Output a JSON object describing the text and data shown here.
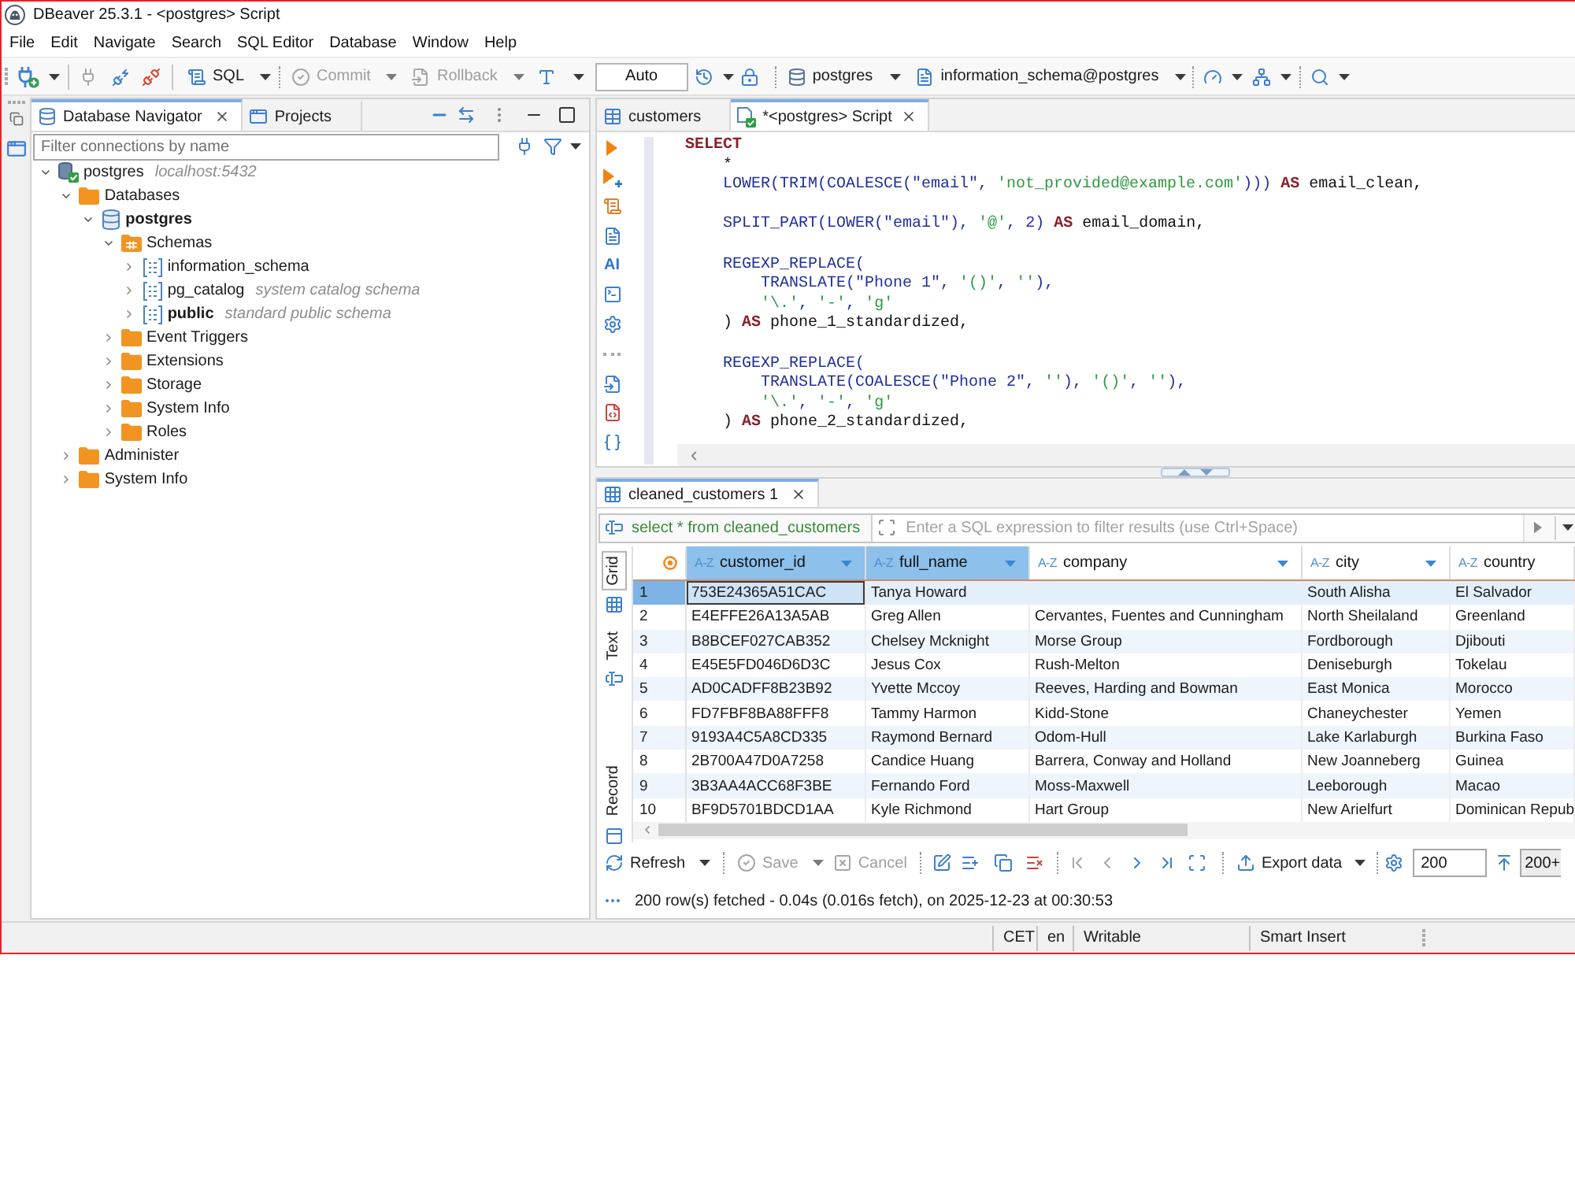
{
  "window": {
    "title": "DBeaver 25.3.1 - <postgres> Script"
  },
  "menu": [
    "File",
    "Edit",
    "Navigate",
    "Search",
    "SQL Editor",
    "Database",
    "Window",
    "Help"
  ],
  "toolbar": {
    "buttons": [
      {
        "kind": "sql",
        "label": "SQL",
        "disabled": false
      },
      {
        "kind": "commit",
        "label": "Commit",
        "disabled": true
      },
      {
        "kind": "rollback",
        "label": "Rollback",
        "disabled": true
      }
    ],
    "transaction_mode": "Auto",
    "datasource": "postgres",
    "schema": "information_schema@postgres"
  },
  "navigator": {
    "tabs": [
      {
        "kind": "database",
        "label": "Database Navigator",
        "selected": true
      },
      {
        "kind": "projects",
        "label": "Projects",
        "selected": false
      }
    ],
    "filter": {
      "placeholder": "Filter connections by name"
    },
    "tree": [
      {
        "kind": "connection",
        "label": "postgres",
        "note": "localhost:5432",
        "active": false,
        "expanded": true,
        "children": [
          {
            "kind": "folder",
            "label": "Databases",
            "active": false,
            "expanded": true,
            "children": [
              {
                "kind": "database",
                "label": "postgres",
                "active": true,
                "expanded": true,
                "children": [
                  {
                    "kind": "schemas",
                    "label": "Schemas",
                    "active": false,
                    "expanded": true,
                    "children": [
                      {
                        "kind": "schema",
                        "label": "information_schema",
                        "active": false,
                        "expanded": false
                      },
                      {
                        "kind": "schema",
                        "label": "pg_catalog",
                        "note": "system catalog schema",
                        "active": false,
                        "expanded": false
                      },
                      {
                        "kind": "schema",
                        "label": "public",
                        "note": "standard public schema",
                        "active": true,
                        "expanded": false
                      }
                    ]
                  },
                  {
                    "kind": "folder",
                    "label": "Event Triggers",
                    "active": false,
                    "expanded": false
                  },
                  {
                    "kind": "folder",
                    "label": "Extensions",
                    "active": false,
                    "expanded": false
                  },
                  {
                    "kind": "folder",
                    "label": "Storage",
                    "active": false,
                    "expanded": false
                  },
                  {
                    "kind": "folder",
                    "label": "System Info",
                    "active": false,
                    "expanded": false
                  },
                  {
                    "kind": "folder",
                    "label": "Roles",
                    "active": false,
                    "expanded": false
                  }
                ]
              }
            ]
          },
          {
            "kind": "folder",
            "label": "Administer",
            "active": false,
            "expanded": false
          },
          {
            "kind": "folder",
            "label": "System Info",
            "active": false,
            "expanded": false
          }
        ]
      }
    ]
  },
  "editor": {
    "tabs": [
      {
        "kind": "table",
        "label": "customers",
        "selected": false
      },
      {
        "kind": "script",
        "label": "*<postgres> Script",
        "selected": true
      }
    ],
    "ai_button": "AI",
    "lines": [
      {
        "kind": "code",
        "tokens": [
          {
            "kind": "keyword",
            "text": "SELECT"
          }
        ],
        "children": [
          {
            "kind": "code",
            "tokens": [
              {
                "kind": "plain",
                "text": "*"
              }
            ]
          },
          {
            "kind": "code",
            "tokens": [
              {
                "kind": "function",
                "text": "LOWER(TRIM(COALESCE(\"email\", "
              },
              {
                "kind": "string",
                "text": "'not_provided@example.com'"
              },
              {
                "kind": "function",
                "text": ")))"
              },
              {
                "kind": "keyword",
                "text": " AS"
              },
              {
                "kind": "plain",
                "text": " email_clean,"
              }
            ]
          },
          {
            "kind": "blank"
          },
          {
            "kind": "code",
            "tokens": [
              {
                "kind": "function",
                "text": "SPLIT_PART(LOWER(\"email\"), "
              },
              {
                "kind": "string",
                "text": "'@'"
              },
              {
                "kind": "function",
                "text": ", "
              },
              {
                "kind": "number",
                "text": "2"
              },
              {
                "kind": "function",
                "text": ")"
              },
              {
                "kind": "keyword",
                "text": " AS"
              },
              {
                "kind": "plain",
                "text": " email_domain,"
              }
            ]
          },
          {
            "kind": "blank"
          },
          {
            "kind": "code",
            "tokens": [
              {
                "kind": "function",
                "text": "REGEXP_REPLACE("
              }
            ],
            "children": [
              {
                "kind": "code",
                "tokens": [
                  {
                    "kind": "function",
                    "text": "TRANSLATE(\"Phone 1\", "
                  },
                  {
                    "kind": "string",
                    "text": "'()'"
                  },
                  {
                    "kind": "function",
                    "text": ", "
                  },
                  {
                    "kind": "string",
                    "text": "''"
                  },
                  {
                    "kind": "function",
                    "text": "),"
                  }
                ]
              },
              {
                "kind": "code",
                "tokens": [
                  {
                    "kind": "string",
                    "text": "'\\.'"
                  },
                  {
                    "kind": "function",
                    "text": ", "
                  },
                  {
                    "kind": "string",
                    "text": "'-'"
                  },
                  {
                    "kind": "function",
                    "text": ", "
                  },
                  {
                    "kind": "string",
                    "text": "'g'"
                  }
                ]
              }
            ]
          },
          {
            "kind": "code",
            "tokens": [
              {
                "kind": "plain",
                "text": ")"
              },
              {
                "kind": "keyword",
                "text": " AS"
              },
              {
                "kind": "plain",
                "text": " phone_1_standardized,"
              }
            ]
          },
          {
            "kind": "blank"
          },
          {
            "kind": "code",
            "tokens": [
              {
                "kind": "function",
                "text": "REGEXP_REPLACE("
              }
            ],
            "children": [
              {
                "kind": "code",
                "tokens": [
                  {
                    "kind": "function",
                    "text": "TRANSLATE(COALESCE(\"Phone 2\", "
                  },
                  {
                    "kind": "string",
                    "text": "''"
                  },
                  {
                    "kind": "function",
                    "text": "), "
                  },
                  {
                    "kind": "string",
                    "text": "'()'"
                  },
                  {
                    "kind": "function",
                    "text": ", "
                  },
                  {
                    "kind": "string",
                    "text": "''"
                  },
                  {
                    "kind": "function",
                    "text": "),"
                  }
                ]
              },
              {
                "kind": "code",
                "tokens": [
                  {
                    "kind": "string",
                    "text": "'\\.'"
                  },
                  {
                    "kind": "function",
                    "text": ", "
                  },
                  {
                    "kind": "string",
                    "text": "'-'"
                  },
                  {
                    "kind": "function",
                    "text": ", "
                  },
                  {
                    "kind": "string",
                    "text": "'g'"
                  }
                ]
              }
            ]
          },
          {
            "kind": "code",
            "tokens": [
              {
                "kind": "plain",
                "text": ")"
              },
              {
                "kind": "keyword",
                "text": " AS"
              },
              {
                "kind": "plain",
                "text": " phone_2_standardized,"
              }
            ]
          }
        ]
      }
    ]
  },
  "results": {
    "tabs": [
      {
        "label": "cleaned_customers 1",
        "selected": true
      }
    ],
    "query": "select * from cleaned_customers",
    "filter": {
      "placeholder": "Enter a SQL expression to filter results (use Ctrl+Space)"
    },
    "views": [
      {
        "kind": "grid",
        "label": "Grid",
        "selected": true
      },
      {
        "kind": "text",
        "label": "Text",
        "selected": false
      },
      {
        "kind": "record",
        "label": "Record",
        "selected": false
      }
    ],
    "table": {
      "columns": [
        {
          "type_label": "A-Z",
          "name": "customer_id",
          "selected": true
        },
        {
          "type_label": "A-Z",
          "name": "full_name",
          "selected": true
        },
        {
          "type_label": "A-Z",
          "name": "company",
          "selected": false
        },
        {
          "type_label": "A-Z",
          "name": "city",
          "selected": false
        },
        {
          "type_label": "A-Z",
          "name": "country",
          "selected": false
        }
      ],
      "rows": [
        {
          "number": "1",
          "selected": true,
          "cells": [
            "753E24365A51CAC",
            "Tanya Howard",
            null,
            "South Alisha",
            "El Salvador"
          ]
        },
        {
          "number": "2",
          "selected": false,
          "cells": [
            "E4EFFE26A13A5AB",
            "Greg Allen",
            "Cervantes, Fuentes and Cunningham",
            "North Sheilaland",
            "Greenland"
          ]
        },
        {
          "number": "3",
          "selected": false,
          "cells": [
            "B8BCEF027CAB352",
            "Chelsey Mcknight",
            "Morse Group",
            "Fordborough",
            "Djibouti"
          ]
        },
        {
          "number": "4",
          "selected": false,
          "cells": [
            "E45E5FD046D6D3C",
            "Jesus Cox",
            "Rush-Melton",
            "Deniseburgh",
            "Tokelau"
          ]
        },
        {
          "number": "5",
          "selected": false,
          "cells": [
            "AD0CADFF8B23B92",
            "Yvette Mccoy",
            "Reeves, Harding and Bowman",
            "East Monica",
            "Morocco"
          ]
        },
        {
          "number": "6",
          "selected": false,
          "cells": [
            "FD7FBF8BA88FFF8",
            "Tammy Harmon",
            "Kidd-Stone",
            "Chaneychester",
            "Yemen"
          ]
        },
        {
          "number": "7",
          "selected": false,
          "cells": [
            "9193A4C5A8CD335",
            "Raymond Bernard",
            "Odom-Hull",
            "Lake Karlaburgh",
            "Burkina Faso"
          ]
        },
        {
          "number": "8",
          "selected": false,
          "cells": [
            "2B700A47D0A7258",
            "Candice Huang",
            "Barrera, Conway and Holland",
            "New Joanneberg",
            "Guinea"
          ]
        },
        {
          "number": "9",
          "selected": false,
          "cells": [
            "3B3AA4ACC68F3BE",
            "Fernando Ford",
            "Moss-Maxwell",
            "Leeborough",
            "Macao"
          ]
        },
        {
          "number": "10",
          "selected": false,
          "cells": [
            "BF9D5701BDCD1AA",
            "Kyle Richmond",
            "Hart Group",
            "New Arielfurt",
            "Dominican Repub"
          ]
        }
      ]
    },
    "toolbar": {
      "buttons": [
        {
          "kind": "refresh",
          "label": "Refresh",
          "disabled": false
        },
        {
          "kind": "save",
          "label": "Save",
          "disabled": true
        },
        {
          "kind": "cancel",
          "label": "Cancel",
          "disabled": true
        },
        {
          "kind": "export",
          "label": "Export data",
          "disabled": false
        }
      ],
      "fetch_size": "200",
      "fetch_more": "200+"
    },
    "status": "200 row(s) fetched - 0.04s (0.016s fetch), on 2025-12-23 at 00:30:53"
  },
  "status_bar": [
    "CET",
    "en",
    "Writable",
    "Smart Insert"
  ]
}
